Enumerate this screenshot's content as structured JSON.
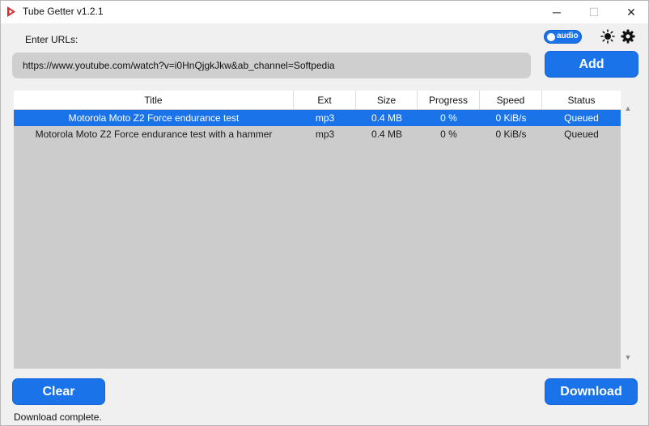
{
  "window": {
    "title": "Tube Getter v1.2.1",
    "minimize_glyph": "─",
    "maximize_glyph": "☐",
    "close_glyph": "✕"
  },
  "form": {
    "urls_label": "Enter URLs:",
    "url_value": "https://www.youtube.com/watch?v=i0HnQjgkJkw&ab_channel=Softpedia",
    "add_label": "Add",
    "audio_toggle_label": "audio",
    "audio_toggle_on": true
  },
  "table": {
    "headers": {
      "title": "Title",
      "ext": "Ext",
      "size": "Size",
      "progress": "Progress",
      "speed": "Speed",
      "status": "Status"
    },
    "rows": [
      {
        "title": "Motorola Moto Z2 Force endurance test",
        "ext": "mp3",
        "size": "0.4 MB",
        "progress": "0 %",
        "speed": "0 KiB/s",
        "status": "Queued",
        "selected": true
      },
      {
        "title": "Motorola Moto Z2 Force endurance test with a hammer",
        "ext": "mp3",
        "size": "0.4 MB",
        "progress": "0 %",
        "speed": "0 KiB/s",
        "status": "Queued",
        "selected": false
      }
    ]
  },
  "footer": {
    "clear_label": "Clear",
    "download_label": "Download",
    "status_message": "Download complete."
  },
  "icons": {
    "app": "red-arrow-icon",
    "theme": "sun-icon",
    "settings": "gear-icon",
    "scroll_up": "scroll-up-arrow-icon",
    "scroll_down": "scroll-down-arrow-icon"
  },
  "colors": {
    "accent": "#1a73e8",
    "selected_row": "#1a73e8",
    "table_bg": "#cccccc",
    "input_bg": "#cfcfcf",
    "app_icon": "#d32f2f"
  }
}
